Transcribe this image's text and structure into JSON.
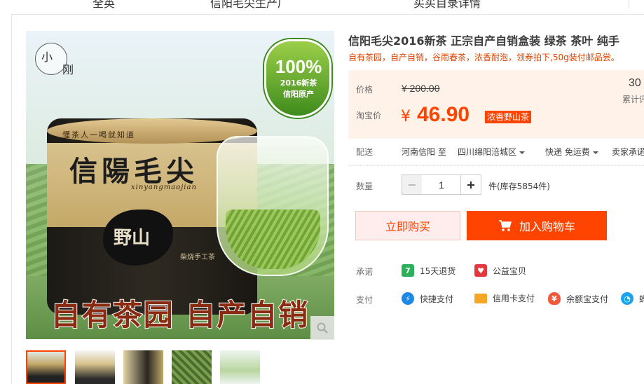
{
  "top_nav": {
    "items": [
      "全英",
      "信阳毛尖生产厂",
      "买买目录详情"
    ]
  },
  "gallery": {
    "main_image": {
      "logo_chars": [
        "小",
        "刚"
      ],
      "badge_percent": "100%",
      "badge_line1": "2016新茶",
      "badge_line2": "信阳原产",
      "tin_slogan": "懂茶人一喝就知道",
      "tin_title": "信陽毛尖",
      "tin_pinyin": "xinyangmaojian",
      "ink_stamp": "野山",
      "tin_sub": "柴烧手工茶",
      "banner": "自有茶园 自产自销"
    },
    "thumbnails": 5,
    "active_thumb": 1
  },
  "product": {
    "title": "信阳毛尖2016新茶 正宗自产自销盒装 绿茶 茶叶 纯手",
    "subtitle": "自有茶园，自产自销，谷雨春茶，浓香耐泡，领券拍下,50g装付邮品尝。"
  },
  "price": {
    "label": "价格",
    "original": "¥ 200.00",
    "taobao_label": "淘宝价",
    "currency": "¥",
    "value": "46.90",
    "tag": "浓香野山茶",
    "sold_count": "30",
    "sold_label": "累计评"
  },
  "shipping": {
    "label": "配送",
    "from": "河南信阳 至",
    "to": "四川绵阳涪城区",
    "method": "快递 免运费",
    "promise": "卖家承诺"
  },
  "quantity": {
    "label": "数量",
    "value": "1",
    "stock": "件(库存5854件)"
  },
  "actions": {
    "buy_now": "立即购买",
    "add_to_cart": "加入购物车"
  },
  "guarantee": {
    "label": "承诺",
    "items": [
      "15天退货",
      "公益宝贝"
    ]
  },
  "payment": {
    "label": "支付",
    "items": [
      "快捷支付",
      "信用卡支付",
      "余额宝支付",
      "蚂"
    ]
  },
  "colors": {
    "accent": "#ff4400",
    "price_bg": "#fff2e8"
  }
}
